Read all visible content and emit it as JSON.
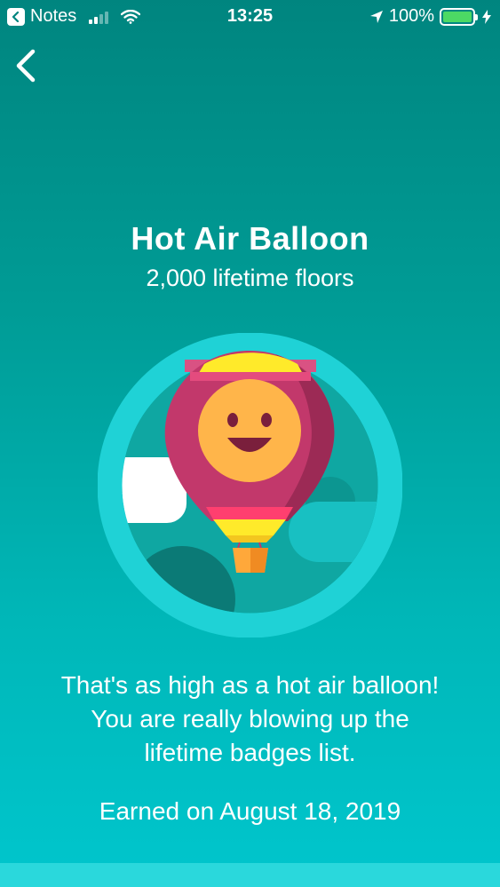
{
  "status_bar": {
    "back_app_label": "Notes",
    "time": "13:25",
    "battery_percent": "100%",
    "battery_level": 1.0,
    "charging": true,
    "signal_bars_filled": 2,
    "signal_bars_total": 4
  },
  "nav": {
    "back_icon": "chevron-left-icon"
  },
  "badge": {
    "title": "Hot Air Balloon",
    "subtitle": "2,000 lifetime floors",
    "icon": "hot-air-balloon-badge",
    "description_lines": [
      "That's as high as a hot air balloon!",
      "You are really blowing up the",
      "lifetime badges list."
    ],
    "earned": "Earned on August 18, 2019"
  },
  "colors": {
    "background_top": "#00857f",
    "background_bottom": "#00c6cd",
    "badge_ring": "#1fd2d6",
    "balloon_body": "#c2386b",
    "balloon_stripe": "#ffea2a",
    "face": "#ffb54a",
    "battery_fill": "#4cd964"
  }
}
